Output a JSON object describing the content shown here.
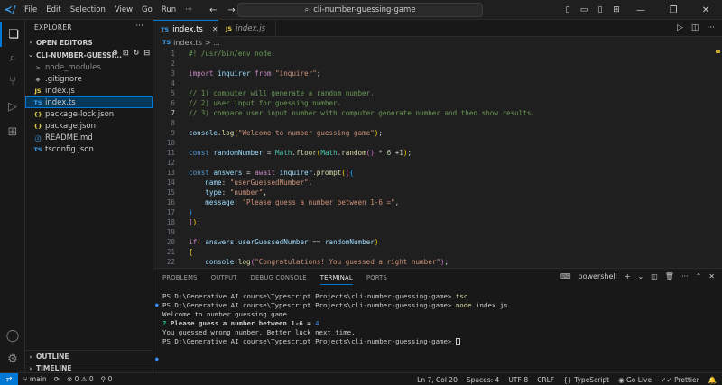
{
  "menu": [
    "File",
    "Edit",
    "Selection",
    "View",
    "Go",
    "Run",
    "···"
  ],
  "command_center": {
    "text": "cli-number-guessing-game"
  },
  "sidebar": {
    "title": "EXPLORER",
    "open_editors": "OPEN EDITORS",
    "project": "CLI-NUMBER-GUESSI...",
    "files": [
      {
        "name": "node_modules",
        "icon": ">",
        "dim": true
      },
      {
        "name": ".gitignore",
        "icon": "◆"
      },
      {
        "name": "index.js",
        "icon": "JS"
      },
      {
        "name": "index.ts",
        "icon": "TS",
        "selected": true
      },
      {
        "name": "package-lock.json",
        "icon": "{}"
      },
      {
        "name": "package.json",
        "icon": "{}"
      },
      {
        "name": "README.md",
        "icon": "ⓘ"
      },
      {
        "name": "tsconfig.json",
        "icon": "TS"
      }
    ],
    "outline": "OUTLINE",
    "timeline": "TIMELINE"
  },
  "tabs": [
    {
      "badge": "TS",
      "label": "index.ts",
      "active": true
    },
    {
      "badge": "JS",
      "label": "index.js",
      "active": false
    }
  ],
  "breadcrumb": {
    "badge": "TS",
    "file": "index.ts",
    "rest": "> ..."
  },
  "code_lines": [
    {
      "n": "1",
      "html": "<span class='c'>#! /usr/bin/env node</span>"
    },
    {
      "n": "2",
      "html": ""
    },
    {
      "n": "3",
      "html": "<span class='k'>import</span> <span class='v'>inquirer</span> <span class='k'>from</span> <span class='s'>\"inquirer\"</span><span class='p'>;</span>"
    },
    {
      "n": "4",
      "html": ""
    },
    {
      "n": "5",
      "html": "<span class='c'>// 1) computer will generate a random number.</span>"
    },
    {
      "n": "6",
      "html": "<span class='c'>// 2) user input for guessing number.</span>"
    },
    {
      "n": "7",
      "html": "<span class='c'>// 3) compare user input number with computer generate number and then show results.</span>"
    },
    {
      "n": "8",
      "html": ""
    },
    {
      "n": "9",
      "html": "<span class='v'>console</span><span class='p'>.</span><span class='f'>log</span><span class='br1'>(</span><span class='s'>\"Welcome to number guessing game\"</span><span class='br1'>)</span><span class='p'>;</span>"
    },
    {
      "n": "10",
      "html": ""
    },
    {
      "n": "11",
      "html": "<span class='kb'>const</span> <span class='v'>randomNumber</span> <span class='p'>=</span> <span class='cls'>Math</span><span class='p'>.</span><span class='f'>floor</span><span class='br1'>(</span><span class='cls'>Math</span><span class='p'>.</span><span class='f'>random</span><span class='br2'>()</span> <span class='p'>*</span> <span class='n'>6</span> <span class='p'>+</span><span class='n'>1</span><span class='br1'>)</span><span class='p'>;</span>"
    },
    {
      "n": "12",
      "html": ""
    },
    {
      "n": "13",
      "html": "<span class='kb'>const</span> <span class='v'>answers</span> <span class='p'>=</span> <span class='k'>await</span> <span class='v'>inquirer</span><span class='p'>.</span><span class='f'>prompt</span><span class='br1'>(</span><span class='br2'>[</span><span class='br3'>{</span>"
    },
    {
      "n": "14",
      "html": "    <span class='v'>name</span><span class='p'>:</span> <span class='s'>\"userGuessedNumber\"</span><span class='p'>,</span>"
    },
    {
      "n": "15",
      "html": "    <span class='v'>type</span><span class='p'>:</span> <span class='s'>\"number\"</span><span class='p'>,</span>"
    },
    {
      "n": "16",
      "html": "    <span class='v'>message</span><span class='p'>:</span> <span class='s'>\"Please guess a number between 1-6 =\"</span><span class='p'>,</span>"
    },
    {
      "n": "17",
      "html": "<span class='br3'>}</span>"
    },
    {
      "n": "18",
      "html": "<span class='br2'>]</span><span class='br1'>)</span><span class='p'>;</span>"
    },
    {
      "n": "19",
      "html": ""
    },
    {
      "n": "20",
      "html": "<span class='k'>if</span><span class='br1'>(</span> <span class='v'>answers</span><span class='p'>.</span><span class='v'>userGuessedNumber</span> <span class='p'>==</span> <span class='v'>randomNumber</span><span class='br1'>)</span>"
    },
    {
      "n": "21",
      "html": "<span class='br1'>{</span>"
    },
    {
      "n": "22",
      "html": "    <span class='v'>console</span><span class='p'>.</span><span class='f'>log</span><span class='br2'>(</span><span class='s'>\"Congratulations! You guessed a right number\"</span><span class='br2'>)</span><span class='p'>;</span>"
    }
  ],
  "panel": {
    "tabs": [
      "PROBLEMS",
      "OUTPUT",
      "DEBUG CONSOLE",
      "TERMINAL",
      "PORTS"
    ],
    "active_tab": "TERMINAL",
    "shell": "powershell"
  },
  "terminal_lines": [
    {
      "mark": "",
      "html": "PS D:\\Generative AI course\\Typescript Projects\\cli-number-guessing-game&gt; <span class='f'>tsc</span>"
    },
    {
      "mark": "●",
      "html": "PS D:\\Generative AI course\\Typescript Projects\\cli-number-guessing-game&gt; <span class='f'>node</span> index.js"
    },
    {
      "mark": "",
      "html": "Welcome to number guessing game"
    },
    {
      "mark": "",
      "html": "<span class='q'>?</span> <b>Please guess a number between 1-6 =</b> <span class='ans'>4</span>"
    },
    {
      "mark": "",
      "html": "You guessed wrong number, Better luck next time."
    },
    {
      "mark": "",
      "html": "PS D:\\Generative AI course\\Typescript Projects\\cli-number-guessing-game&gt; <span class='cursor'></span>"
    },
    {
      "mark": "",
      "html": ""
    },
    {
      "mark": "●",
      "html": ""
    }
  ],
  "status": {
    "branch": "main",
    "sync": "⟳",
    "errors": "0",
    "warnings": "0",
    "ports": "0",
    "position": "Ln 7, Col 20",
    "spaces": "Spaces: 4",
    "encoding": "UTF-8",
    "eol": "CRLF",
    "language": "TypeScript",
    "golive": "Go Live",
    "prettier": "Prettier"
  }
}
